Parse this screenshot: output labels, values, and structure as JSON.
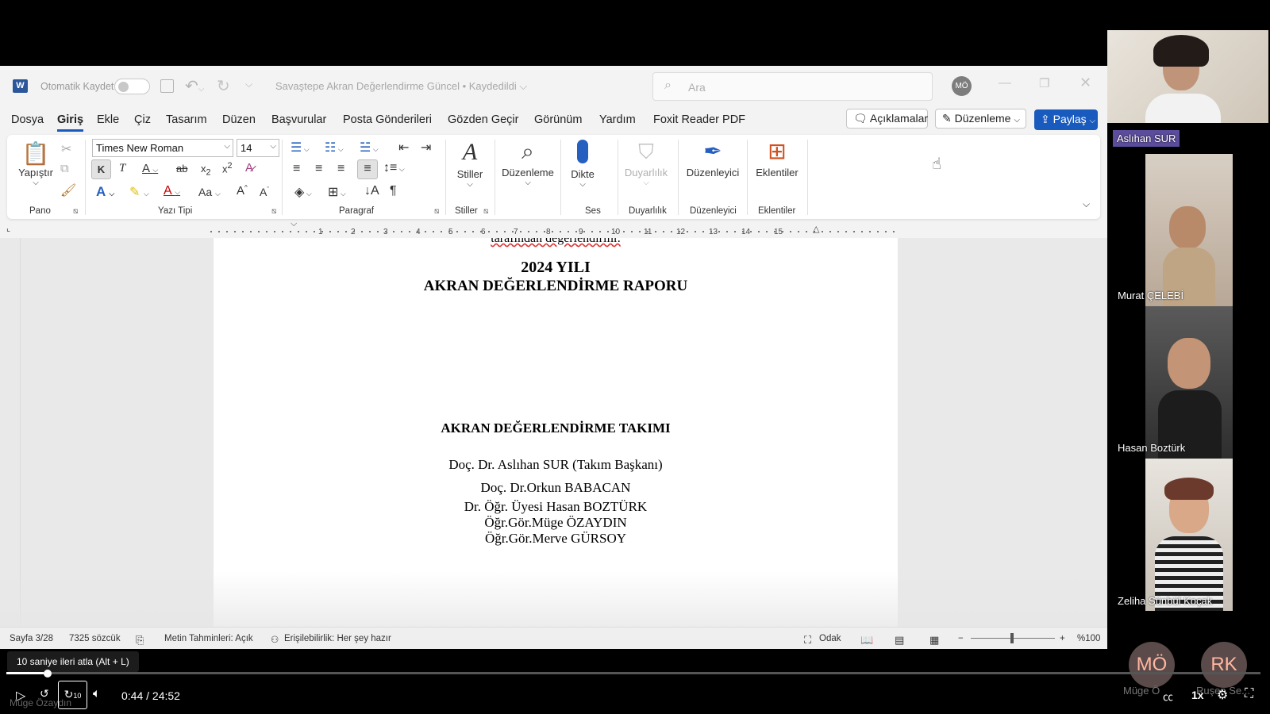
{
  "titlebar": {
    "app_icon": "word-logo",
    "autosave_label": "Otomatik Kaydet",
    "doc_title": "Savaştepe Akran Değerlendirme Güncel • Kaydedildi ⌵",
    "search_placeholder": "Ara",
    "user_initials": "MÖ"
  },
  "menu": {
    "tabs": [
      "Dosya",
      "Giriş",
      "Ekle",
      "Çiz",
      "Tasarım",
      "Düzen",
      "Başvurular",
      "Posta Gönderileri",
      "Gözden Geçir",
      "Görünüm",
      "Yardım",
      "Foxit Reader PDF"
    ],
    "active_tab": "Giriş",
    "comments_label": "Açıklamalar",
    "editing_label": "Düzenleme",
    "share_label": "Paylaş"
  },
  "ribbon": {
    "paste_label": "Yapıştır",
    "font_name": "Times New Roman",
    "font_size": "14",
    "styles_label": "Stiller",
    "editing_label": "Düzenleme",
    "dictate_label": "Dikte",
    "sensitivity_label": "Duyarlılık",
    "editor_label": "Düzenleyici",
    "addins_label": "Eklentiler",
    "groups": {
      "clipboard": "Pano",
      "font": "Yazı Tipi",
      "paragraph": "Paragraf",
      "styles": "Stiller",
      "voice": "Ses",
      "sensitivity": "Duyarlılık",
      "editor": "Düzenleyici",
      "addins": "Eklentiler"
    }
  },
  "ruler": {
    "numbers": [
      "1",
      "2",
      "3",
      "4",
      "5",
      "6",
      "7",
      "8",
      "9",
      "10",
      "11",
      "12",
      "13",
      "14",
      "15"
    ]
  },
  "document": {
    "cut_line": "tarafından değerlendirilir.",
    "year_line": "2024 YILI",
    "report_title": "AKRAN DEĞERLENDİRME RAPORU",
    "team_heading": "AKRAN DEĞERLENDİRME TAKIMI",
    "members": [
      "Doç. Dr. Aslıhan SUR (Takım Başkanı)",
      "Doç. Dr.Orkun BABACAN",
      "Dr. Öğr. Üyesi Hasan BOZTÜRK",
      "Öğr.Gör.Müge ÖZAYDIN",
      "Öğr.Gör.Merve GÜRSOY"
    ]
  },
  "statusbar": {
    "page": "Sayfa 3/28",
    "words": "7325 sözcük",
    "predictions": "Metin Tahminleri: Açık",
    "accessibility": "Erişilebilirlik: Her şey hazır",
    "focus": "Odak",
    "zoom": "%100"
  },
  "video": {
    "tooltip": "10 saniye ileri atla (Alt + L)",
    "time": "0:44 / 24:52",
    "progress": 0.0295,
    "skip_seconds": "10",
    "speed": "1x",
    "presenter_watermark": "Müge Özaydın"
  },
  "participants": [
    {
      "name": "Aslıhan SUR"
    },
    {
      "name": "Murat ÇELEBİ"
    },
    {
      "name": "Hasan Boztürk"
    },
    {
      "name": "Zeliha Sünbül Koçak"
    }
  ],
  "avatars": [
    {
      "initials": "MÖ",
      "name": "Müge Ö"
    },
    {
      "initials": "RK",
      "name": "Ruşen Se..."
    }
  ],
  "colors": {
    "word_blue": "#185abd",
    "share_blue": "#185abd",
    "avatar_text": "#ffb6a0"
  }
}
